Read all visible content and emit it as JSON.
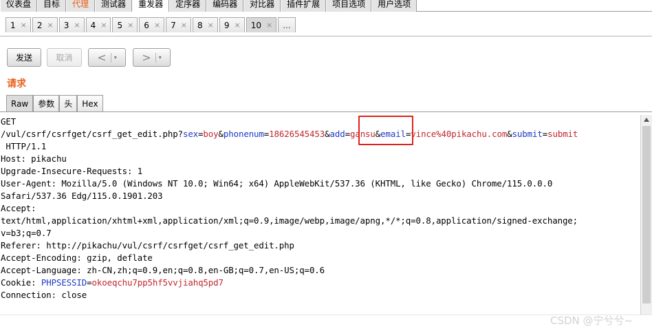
{
  "top_tabs": [
    {
      "label": "仪表盘"
    },
    {
      "label": "目标"
    },
    {
      "label": "代理"
    },
    {
      "label": "测试器"
    },
    {
      "label": "重发器"
    },
    {
      "label": "定序器"
    },
    {
      "label": "编码器"
    },
    {
      "label": "对比器"
    },
    {
      "label": "插件扩展"
    },
    {
      "label": "项目选项"
    },
    {
      "label": "用户选项"
    }
  ],
  "num_tabs": [
    "1",
    "2",
    "3",
    "4",
    "5",
    "6",
    "7",
    "8",
    "9",
    "10"
  ],
  "num_tabs_more": "...",
  "close_glyph": "×",
  "toolbar": {
    "send_label": "发送",
    "cancel_label": "取消",
    "back_icon": "<",
    "forward_icon": ">",
    "dropdown_icon": "▾"
  },
  "request_title": "请求",
  "sub_tabs": [
    "Raw",
    "参数",
    "头",
    "Hex"
  ],
  "request": {
    "method": "GET",
    "path": "/vul/csrf/csrfget/csrf_get_edit.php?",
    "params": [
      {
        "key": "sex",
        "value": "boy"
      },
      {
        "key": "phonenum",
        "value": "18626545453"
      },
      {
        "key": "add",
        "value": "gansu"
      },
      {
        "key": "email",
        "value": "vince%40pikachu.com"
      },
      {
        "key": "submit",
        "value": "submit"
      }
    ],
    "protocol": " HTTP/1.1",
    "host": "Host: pikachu",
    "upgrade": "Upgrade-Insecure-Requests: 1",
    "ua1": "User-Agent: Mozilla/5.0 (Windows NT 10.0; Win64; x64) AppleWebKit/537.36 (KHTML, like Gecko) Chrome/115.0.0.0",
    "ua2": "Safari/537.36 Edg/115.0.1901.203",
    "accept_label": "Accept:",
    "accept1": "text/html,application/xhtml+xml,application/xml;q=0.9,image/webp,image/apng,*/*;q=0.8,application/signed-exchange;",
    "accept2": "v=b3;q=0.7",
    "referer": "Referer: http://pikachu/vul/csrf/csrfget/csrf_get_edit.php",
    "encoding": "Accept-Encoding: gzip, deflate",
    "language": "Accept-Language: zh-CN,zh;q=0.9,en;q=0.8,en-GB;q=0.7,en-US;q=0.6",
    "cookie_label": "Cookie: ",
    "cookie_key": "PHPSESSID",
    "cookie_value": "okoeqchu7pp5hf5vvjiahq5pd7",
    "connection": "Connection: close"
  },
  "watermark": "CSDN @宁兮兮~",
  "colors": {
    "accent": "#e8601c",
    "param_key": "#1d38c4",
    "param_value": "#c0262e",
    "highlight": "#e0201a"
  }
}
